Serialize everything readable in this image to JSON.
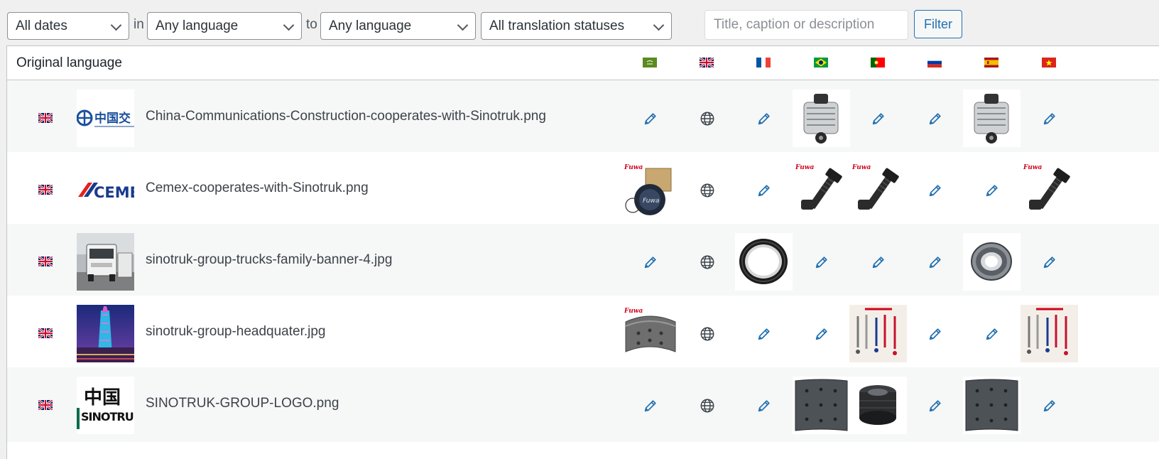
{
  "filters": {
    "dates": "All dates",
    "in_label": "in",
    "from_language": "Any language",
    "to_label": "to",
    "to_language": "Any language",
    "statuses": "All translation statuses",
    "search_placeholder": "Title, caption or description",
    "filter_button": "Filter"
  },
  "table": {
    "header": {
      "title": "Original language",
      "languages": [
        "ar",
        "en",
        "fr",
        "pt-br",
        "pt-pt",
        "ru",
        "es",
        "vi"
      ]
    },
    "rows": [
      {
        "original_language": "en",
        "thumbnail": "china-communications-logo",
        "filename": "China-Communications-Construction-cooperates-with-Sinotruk.png",
        "translations": [
          "edit",
          "original",
          "edit",
          "image-alternator",
          "edit",
          "edit",
          "image-alternator",
          "edit"
        ]
      },
      {
        "original_language": "en",
        "thumbnail": "cemex-logo",
        "filename": "Cemex-cooperates-with-Sinotruk.png",
        "translations": [
          "image-hub-cap",
          "original",
          "edit",
          "image-wheel-bolt",
          "image-wheel-bolt",
          "edit",
          "edit",
          "image-wheel-bolt"
        ]
      },
      {
        "original_language": "en",
        "thumbnail": "truck-photo",
        "filename": "sinotruk-group-trucks-family-banner-4.jpg",
        "translations": [
          "edit",
          "original",
          "image-oil-seal",
          "edit",
          "edit",
          "edit",
          "image-bearing",
          "edit"
        ]
      },
      {
        "original_language": "en",
        "thumbnail": "headquarters-photo",
        "filename": "sinotruk-group-headquater.jpg",
        "translations": [
          "image-brake-shoe",
          "original",
          "edit",
          "edit",
          "image-brake-springs",
          "edit",
          "edit",
          "image-brake-springs"
        ]
      },
      {
        "original_language": "en",
        "thumbnail": "sinotruk-logo",
        "filename": "SINOTRUK-GROUP-LOGO.png",
        "translations": [
          "edit",
          "original",
          "edit",
          "image-brake-lining",
          "image-brake-drum",
          "edit",
          "image-brake-lining",
          "edit"
        ]
      }
    ]
  },
  "colors": {
    "accent": "#2271b1",
    "row_alt": "#f6f7f7",
    "background": "#f0f0f1"
  },
  "image_texts": {
    "fuwa_brand": "Fuwa",
    "china_comm_logo": "中国交",
    "cemex_logo": "CEME",
    "sinotruk_logo_cn": "中国",
    "sinotruk_logo_en": "SINOTRUK"
  }
}
